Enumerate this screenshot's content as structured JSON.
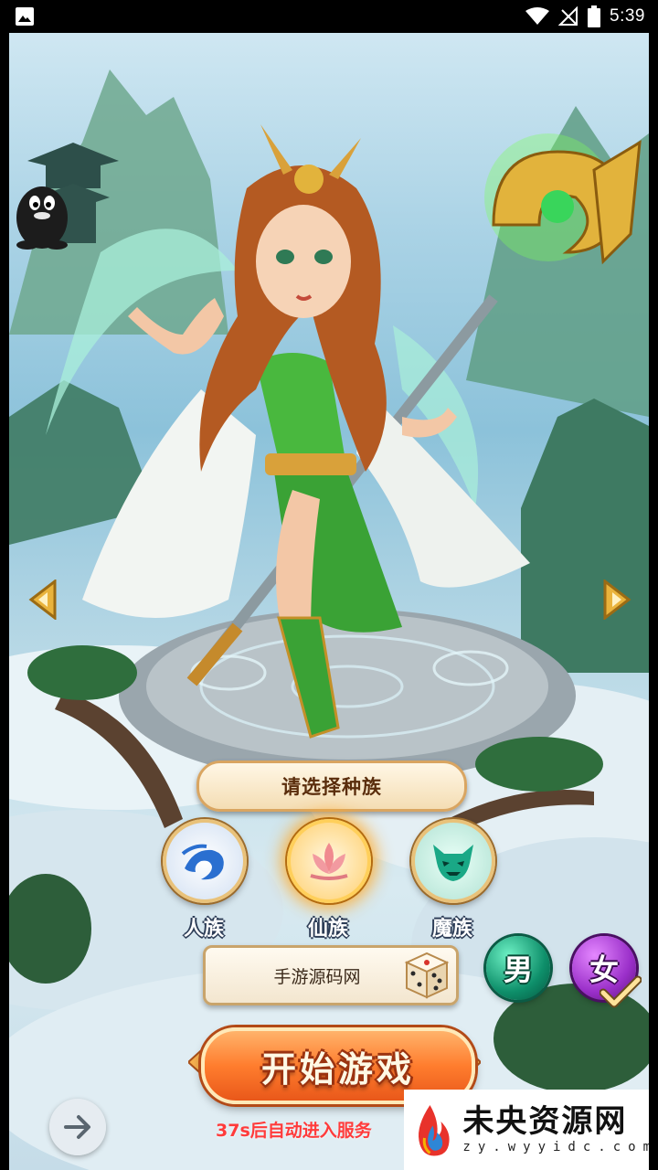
{
  "status_bar": {
    "time": "5:39",
    "icons": [
      "image-notification-icon",
      "wifi-icon",
      "signal-icon",
      "battery-icon"
    ]
  },
  "race_select": {
    "banner_label": "请选择种族",
    "races": [
      {
        "label": "人族",
        "selected": false
      },
      {
        "label": "仙族",
        "selected": true
      },
      {
        "label": "魔族",
        "selected": false
      }
    ]
  },
  "name_field": {
    "value": "手游源码网"
  },
  "gender": {
    "male_label": "男",
    "female_label": "女",
    "selected": "female"
  },
  "start_button": {
    "label": "开始游戏"
  },
  "countdown_text": "37s后自动进入服务",
  "watermark": {
    "title": "未央资源网",
    "url": "zy.wyyidc.com"
  },
  "colors": {
    "accent_orange": "#ff7d2e",
    "countdown_red": "#ff3b3b",
    "banner_brown": "#5a2d0c"
  }
}
